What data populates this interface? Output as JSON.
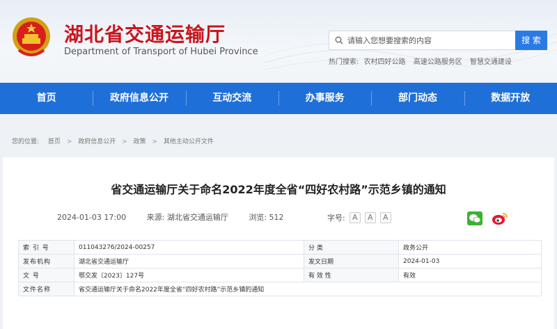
{
  "header": {
    "title": "湖北省交通运输厅",
    "subtitle": "Department of Transport of Hubei Province",
    "search_placeholder": "请输入您想要搜索的内容",
    "search_button": "搜 索",
    "hot_label": "热门搜索:",
    "hot_items": [
      "农村四好公路",
      "高速公路服务区",
      "智慧交通建设"
    ]
  },
  "nav": [
    "首页",
    "政府信息公开",
    "互动交流",
    "办事服务",
    "部门动态",
    "数据开放"
  ],
  "breadcrumb": [
    "您的位置:",
    "首页",
    "政府信息公开",
    "政策",
    "其他主动公开文件"
  ],
  "article": {
    "title": "省交通运输厅关于命名2022年度全省“四好农村路”示范乡镇的通知",
    "date": "2024-01-03 17:00",
    "source": "来源:  湖北省交通运输厅",
    "views": "浏览:  512",
    "font_label": "字号:",
    "font_btns": [
      "A",
      "A",
      "A"
    ]
  },
  "info_table": [
    {
      "k1": "索 引 号",
      "v1": "011043276/2024-00257",
      "k2": "分    类",
      "v2": "政务公开"
    },
    {
      "k1": "发布机构",
      "v1": "湖北省交通运输厅",
      "k2": "发文日期",
      "v2": "2024-01-03"
    },
    {
      "k1": "文    号",
      "v1": "鄂交发〔2023〕127号",
      "k2": "有 效 性",
      "v2": "有效"
    },
    {
      "k1": "文件名称",
      "v1": "省交通运输厅关于命名2022年度全省“四好农村路”示范乡镇的通知"
    }
  ],
  "colors": {
    "brand_red": "#c8161d",
    "nav_blue": "#1f6fd8",
    "search_blue": "#2b7ae4"
  }
}
